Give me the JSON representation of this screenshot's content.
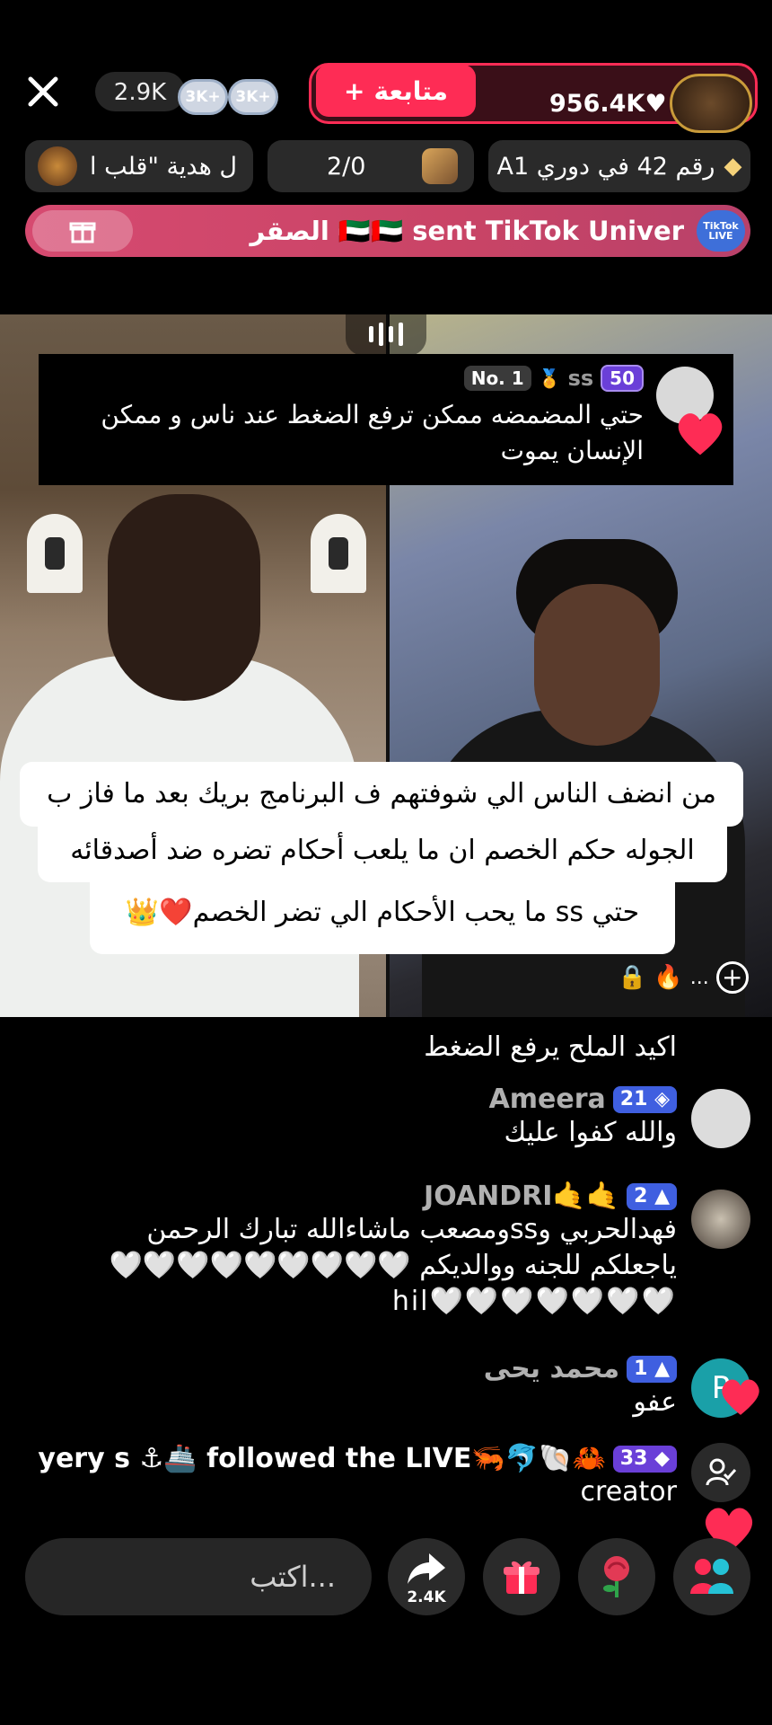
{
  "header": {
    "viewer_count": "2.9K",
    "badges": [
      "3K+",
      "3K+"
    ],
    "follow_label": "متابعة",
    "host_likes": "956.4K"
  },
  "chips": {
    "gift_text": "ل هدية \"قلب ا",
    "round_score": "2/0",
    "rank_text": "رقم 42 في دوري A1"
  },
  "gift_banner": {
    "text": "الصقر 🇦🇪🇦🇪 sent TikTok Univer",
    "badge": "TikTok LIVE"
  },
  "pinned_comment": {
    "rank": "No. 1",
    "username": "ss",
    "level": "50",
    "text": "حتي المضمضه ممكن ترفع الضغط عند ناس و ممكن الإنسان يموت"
  },
  "caption": {
    "line1": "من انضف الناس الي شوفتهم ف البرنامج بريك بعد ما فاز ب",
    "line2": "الجوله حكم الخصم ان ما يلعب أحكام تضره ضد أصدقائه",
    "line3": "حتي ss ما يحب الأحكام الي تضر الخصم❤️👑"
  },
  "comments": [
    {
      "text": "اكيد الملح يرفع الضغط"
    },
    {
      "username": "Ameera",
      "level": "21",
      "text": "والله كفوا عليك"
    },
    {
      "username": "JOANDRI🤙🤙",
      "level": "2",
      "text1": "فهدالحربي وssومصعب ماشاءالله تبارك الرحمن",
      "text2": "ياجعلكم للجنه ووالديكم 🤍🤍🤍🤍🤍🤍🤍🤍🤍",
      "text3": "hil🤍🤍🤍🤍🤍🤍🤍"
    },
    {
      "username": "محمد يحى",
      "level": "1",
      "text": "عفو",
      "avatar_letter": "P"
    },
    {
      "username": "yery s ⚓🚢 followed the LIVE🦐🐬🐚🦀",
      "level": "33",
      "text": "creator"
    }
  ],
  "bottom_bar": {
    "input_placeholder": "...اكتب",
    "share_count": "2.4K"
  },
  "colors": {
    "accent": "#fe2c55",
    "gift_banner": "#d64a70"
  }
}
